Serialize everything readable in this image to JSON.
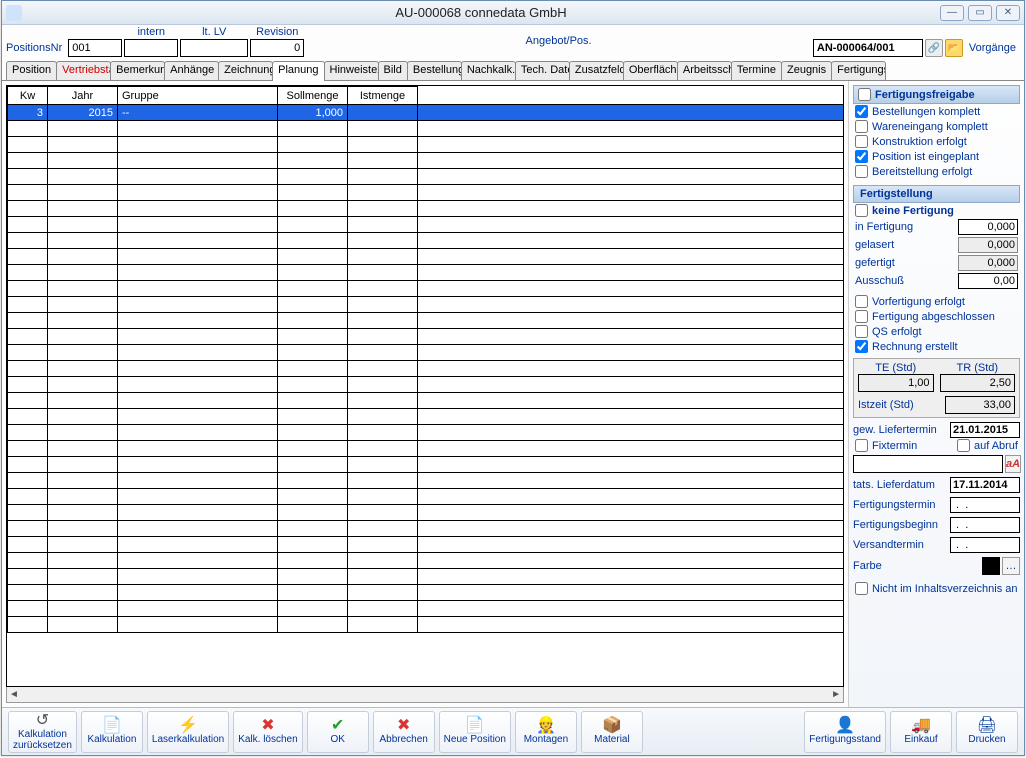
{
  "title": "AU-000068 connedata GmbH",
  "header": {
    "positionsnr_label": "PositionsNr",
    "positionsnr": "001",
    "intern_label": "intern",
    "intern": "",
    "ltlv_label": "lt. LV",
    "ltlv": "",
    "revision_label": "Revision",
    "revision": "0",
    "angebot_label": "Angebot/Pos.",
    "angebot": "AN-000064/001",
    "vorgaenge_label": "Vorgänge"
  },
  "tabs": [
    "Position",
    "Vertriebsta",
    "Bemerkung",
    "Anhänge",
    "Zeichnung",
    "Planung",
    "Hinweistext",
    "Bild",
    "Bestellung",
    "Nachkalk.",
    "Tech. Date",
    "Zusatzfeld",
    "Oberfläche",
    "Arbeitssch",
    "Termine",
    "Zeugnis",
    "Fertigungss"
  ],
  "active_tab_index": 5,
  "grid": {
    "cols": [
      "Kw",
      "Jahr",
      "Gruppe",
      "Sollmenge",
      "Istmenge"
    ],
    "rows": [
      {
        "kw": "3",
        "jahr": "2015",
        "gruppe": "--",
        "soll": "1,000",
        "ist": ""
      }
    ],
    "empty_rows": 32
  },
  "side": {
    "freigabe_title": "Fertigungsfreigabe",
    "checks1": [
      {
        "label": "Bestellungen komplett",
        "checked": true
      },
      {
        "label": "Wareneingang komplett",
        "checked": false
      },
      {
        "label": "Konstruktion erfolgt",
        "checked": false
      },
      {
        "label": "Position ist eingeplant",
        "checked": true
      },
      {
        "label": "Bereitstellung erfolgt",
        "checked": false
      }
    ],
    "fertigstellung_title": "Fertigstellung",
    "keine_fertigung_label": "keine Fertigung",
    "kv": [
      {
        "label": "in Fertigung",
        "value": "0,000",
        "ro": false
      },
      {
        "label": "gelasert",
        "value": "0,000",
        "ro": true
      },
      {
        "label": "gefertigt",
        "value": "0,000",
        "ro": true
      },
      {
        "label": "Ausschuß",
        "value": "0,00",
        "ro": false
      }
    ],
    "checks2": [
      {
        "label": "Vorfertigung erfolgt",
        "checked": false
      },
      {
        "label": "Fertigung abgeschlossen",
        "checked": false
      },
      {
        "label": "QS erfolgt",
        "checked": false
      },
      {
        "label": "Rechnung erstellt",
        "checked": true
      }
    ],
    "te_label": "TE (Std)",
    "te": "1,00",
    "tr_label": "TR (Std)",
    "tr": "2,50",
    "istzeit_label": "Istzeit (Std)",
    "istzeit": "33,00",
    "gew_liefertermin_label": "gew. Liefertermin",
    "gew_liefertermin": "21.01.2015",
    "fixtermin_label": "Fixtermin",
    "auf_abruf_label": "auf Abruf",
    "tats_lieferdatum_label": "tats. Lieferdatum",
    "tats_lieferdatum": "17.11.2014",
    "fertigungstermin_label": "Fertigungstermin",
    "fertigungstermin": " .  . ",
    "fertigungsbeginn_label": "Fertigungsbeginn",
    "fertigungsbeginn": " .  . ",
    "versandtermin_label": "Versandtermin",
    "versandtermin": " .  . ",
    "farbe_label": "Farbe",
    "nicht_iv_label": "Nicht im Inhaltsverzeichnis anz."
  },
  "buttons": [
    {
      "label": "Kalkulation\nzurücksetzen",
      "icon": "↺"
    },
    {
      "label": "Kalkulation",
      "icon": "📄"
    },
    {
      "label": "Laserkalkulation",
      "icon": "⚡"
    },
    {
      "label": "Kalk. löschen",
      "icon": "✖"
    },
    {
      "label": "OK",
      "icon": "✔"
    },
    {
      "label": "Abbrechen",
      "icon": "✖"
    },
    {
      "label": "Neue Position",
      "icon": "📄"
    },
    {
      "label": "Montagen",
      "icon": "👷"
    },
    {
      "label": "Material",
      "icon": "📦"
    }
  ],
  "buttons_right": [
    {
      "label": "Fertigungsstand",
      "icon": "👤"
    },
    {
      "label": "Einkauf",
      "icon": "🚚"
    },
    {
      "label": "Drucken",
      "icon": "🖨"
    }
  ]
}
